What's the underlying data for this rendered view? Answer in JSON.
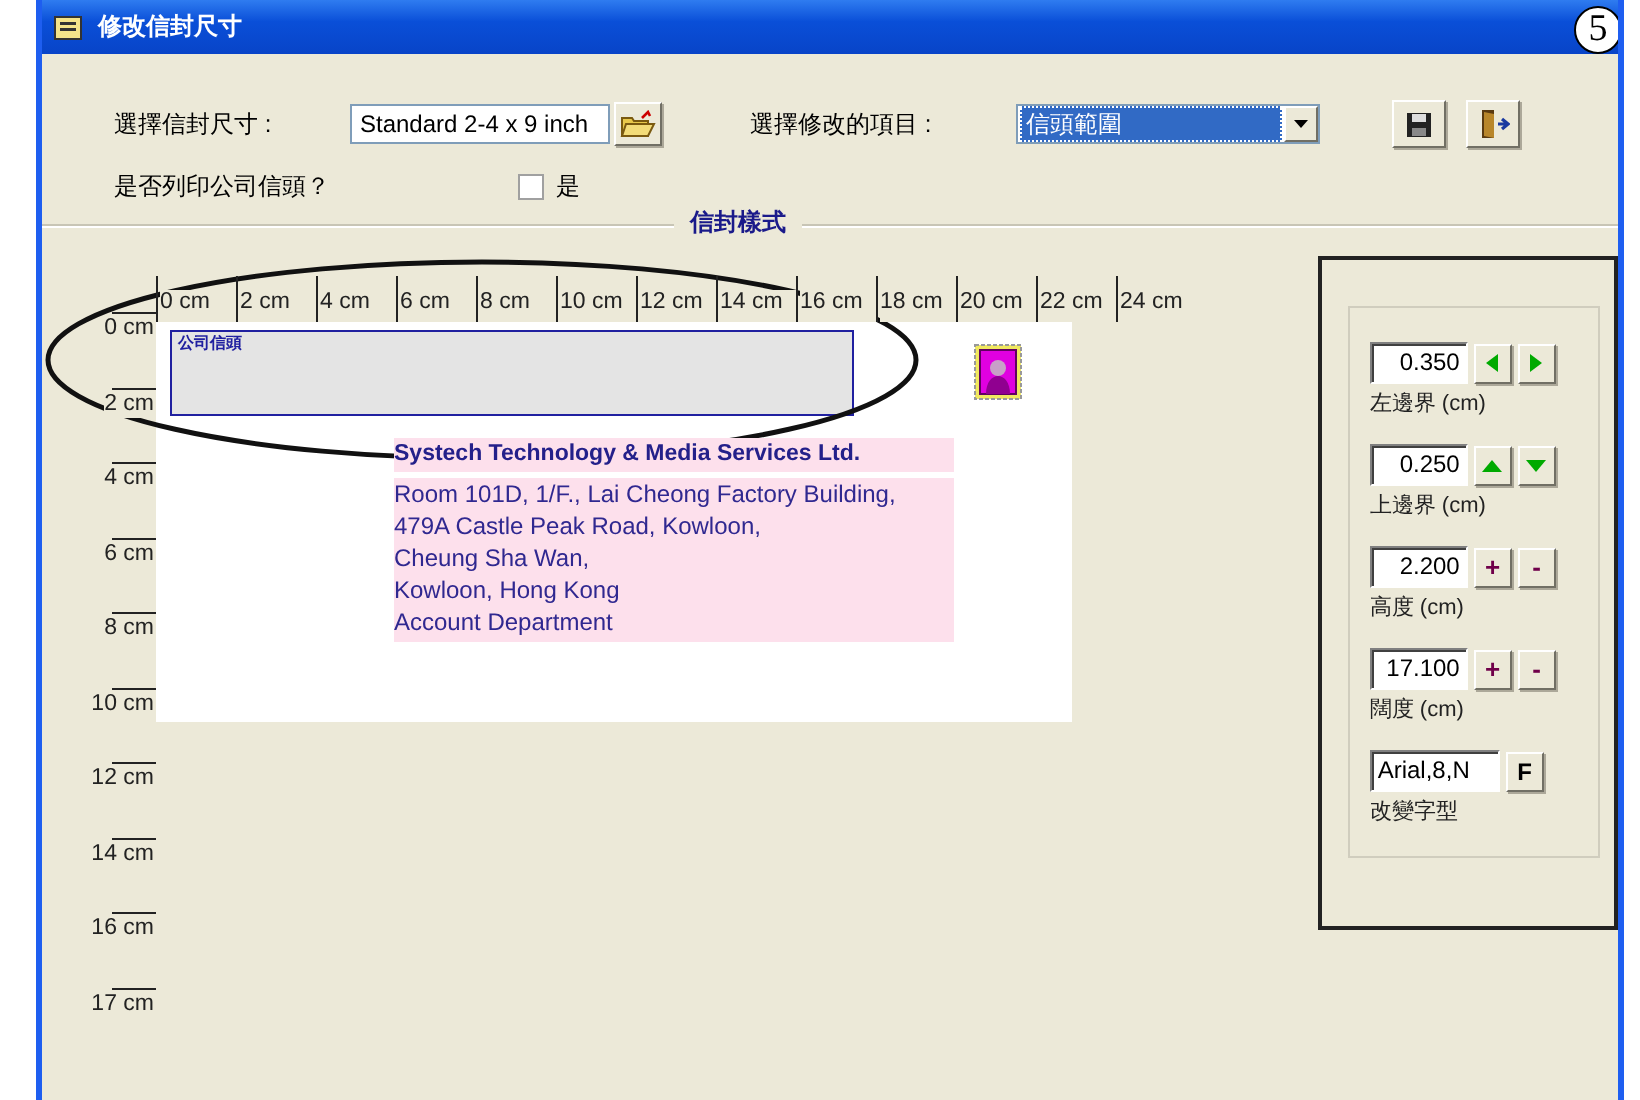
{
  "window": {
    "title": "修改信封尺寸",
    "callout": "5"
  },
  "envelope_size": {
    "label": "選擇信封尺寸 :",
    "value": "Standard 2-4 x 9 inch"
  },
  "edit_item": {
    "label": "選擇修改的項目 :",
    "value": "信頭範圍"
  },
  "print_letterhead": {
    "label": "是否列印公司信頭？",
    "option": "是",
    "checked": false
  },
  "section_title": "信封樣式",
  "ruler_x": [
    "0 cm",
    "2 cm",
    "4 cm",
    "6 cm",
    "8 cm",
    "10 cm",
    "12 cm",
    "14 cm",
    "16 cm",
    "18 cm",
    "20 cm",
    "22 cm",
    "24 cm"
  ],
  "ruler_y": [
    "0 cm",
    "2 cm",
    "4 cm",
    "6 cm",
    "8 cm",
    "10 cm",
    "12 cm",
    "14 cm",
    "16 cm",
    "17 cm"
  ],
  "envelope": {
    "header_label": "公司信頭",
    "company": "Systech Technology & Media Services Ltd.",
    "address_lines": [
      "Room 101D, 1/F., Lai Cheong Factory Building,",
      "479A Castle Peak Road, Kowloon,",
      "Cheung Sha Wan,",
      "Kowloon, Hong Kong",
      "Account Department"
    ]
  },
  "settings": [
    {
      "kind": "horizontal",
      "value": "0.350",
      "label": "左邊界 (cm)"
    },
    {
      "kind": "vertical",
      "value": "0.250",
      "label": "上邊界 (cm)"
    },
    {
      "kind": "plusminus",
      "value": "2.200",
      "label": "高度 (cm)",
      "buttons": [
        "+",
        "-"
      ]
    },
    {
      "kind": "plusminus",
      "value": "17.100",
      "label": "闊度 (cm)",
      "buttons": [
        "+",
        "-"
      ]
    },
    {
      "kind": "font",
      "value": "Arial,8,N",
      "label": "改變字型",
      "buttons": [
        "F"
      ]
    }
  ]
}
